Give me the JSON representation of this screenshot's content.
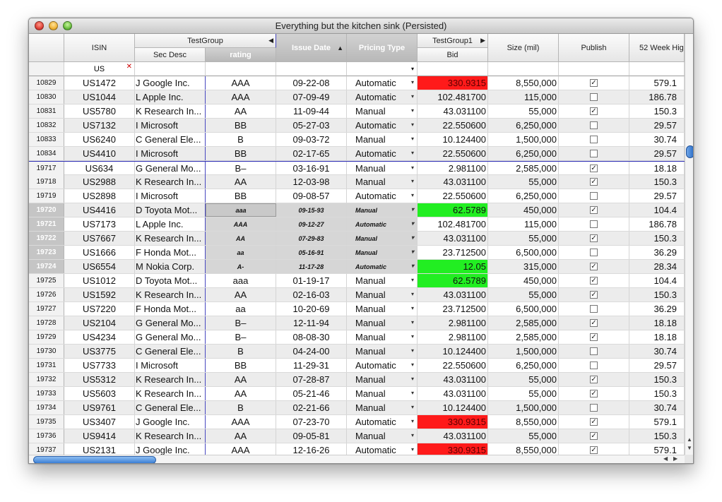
{
  "window": {
    "title": "Everything but the kitchen sink (Persisted)"
  },
  "headers": {
    "isin": "ISIN",
    "testgroup": "TestGroup",
    "sec_desc": "Sec Desc",
    "rating": "rating",
    "issue_date": "Issue Date",
    "pricing_type": "Pricing Type",
    "testgroup1": "TestGroup1",
    "bid": "Bid",
    "size": "Size (mil)",
    "publish": "Publish",
    "week52": "52 Week Hig"
  },
  "filter": {
    "isin": "US"
  },
  "colors": {
    "red_bid": "#ff1a1a",
    "green_bid": "#22ee22",
    "group_line": "#2d2db4",
    "scroll_thumb": "#3b7ed4"
  },
  "rows": [
    {
      "id": "10829",
      "isin": "US1472",
      "desc": "J Google Inc.",
      "rating": "AAA",
      "date": "09-22-08",
      "ptype": "Automatic",
      "bid": "330.9315",
      "bidc": "red",
      "size": "8,550,000",
      "pub": true,
      "wk": "579.1"
    },
    {
      "id": "10830",
      "isin": "US1044",
      "desc": "L Apple Inc.",
      "rating": "AAA",
      "date": "07-09-49",
      "ptype": "Automatic",
      "bid": "102.481700",
      "bidc": "",
      "size": "115,000",
      "pub": false,
      "wk": "186.78"
    },
    {
      "id": "10831",
      "isin": "US5780",
      "desc": "K Research In...",
      "rating": "AA",
      "date": "11-09-44",
      "ptype": "Manual",
      "bid": "43.031100",
      "bidc": "",
      "size": "55,000",
      "pub": true,
      "wk": "150.3"
    },
    {
      "id": "10832",
      "isin": "US7132",
      "desc": "I Microsoft",
      "rating": "BB",
      "date": "05-27-03",
      "ptype": "Automatic",
      "bid": "22.550600",
      "bidc": "",
      "size": "6,250,000",
      "pub": false,
      "wk": "29.57"
    },
    {
      "id": "10833",
      "isin": "US6240",
      "desc": "C General Ele...",
      "rating": "B",
      "date": "09-03-72",
      "ptype": "Manual",
      "bid": "10.124400",
      "bidc": "",
      "size": "1,500,000",
      "pub": false,
      "wk": "30.74"
    },
    {
      "id": "10834",
      "isin": "US4410",
      "desc": "I Microsoft",
      "rating": "BB",
      "date": "02-17-65",
      "ptype": "Automatic",
      "bid": "22.550600",
      "bidc": "",
      "size": "6,250,000",
      "pub": false,
      "wk": "29.57"
    },
    {
      "id": "19717",
      "isin": "US634",
      "desc": "G General Mo...",
      "rating": "B–",
      "date": "03-16-91",
      "ptype": "Manual",
      "bid": "2.981100",
      "bidc": "",
      "size": "2,585,000",
      "pub": true,
      "wk": "18.18",
      "gtop": true
    },
    {
      "id": "19718",
      "isin": "US2988",
      "desc": "K Research In...",
      "rating": "AA",
      "date": "12-03-98",
      "ptype": "Manual",
      "bid": "43.031100",
      "bidc": "",
      "size": "55,000",
      "pub": true,
      "wk": "150.3"
    },
    {
      "id": "19719",
      "isin": "US2898",
      "desc": "I Microsoft",
      "rating": "BB",
      "date": "09-08-57",
      "ptype": "Automatic",
      "bid": "22.550600",
      "bidc": "",
      "size": "6,250,000",
      "pub": false,
      "wk": "29.57"
    },
    {
      "id": "19720",
      "isin": "US4416",
      "desc": "D Toyota Mot...",
      "rating": "aaa",
      "date": "09-15-93",
      "ptype": "Manual",
      "bid": "62.5789",
      "bidc": "green",
      "size": "450,000",
      "pub": true,
      "wk": "104.4",
      "sel": true,
      "first": true
    },
    {
      "id": "19721",
      "isin": "US7173",
      "desc": "L Apple Inc.",
      "rating": "AAA",
      "date": "09-12-27",
      "ptype": "Automatic",
      "bid": "102.481700",
      "bidc": "",
      "size": "115,000",
      "pub": false,
      "wk": "186.78",
      "sel": true
    },
    {
      "id": "19722",
      "isin": "US7667",
      "desc": "K Research In...",
      "rating": "AA",
      "date": "07-29-83",
      "ptype": "Manual",
      "bid": "43.031100",
      "bidc": "",
      "size": "55,000",
      "pub": true,
      "wk": "150.3",
      "sel": true
    },
    {
      "id": "19723",
      "isin": "US1666",
      "desc": "F Honda Mot...",
      "rating": "aa",
      "date": "05-16-91",
      "ptype": "Manual",
      "bid": "23.712500",
      "bidc": "",
      "size": "6,500,000",
      "pub": false,
      "wk": "36.29",
      "sel": true
    },
    {
      "id": "19724",
      "isin": "US6554",
      "desc": "M Nokia Corp.",
      "rating": "A-",
      "date": "11-17-28",
      "ptype": "Automatic",
      "bid": "12.05",
      "bidc": "green",
      "size": "315,000",
      "pub": true,
      "wk": "28.34",
      "sel": true
    },
    {
      "id": "19725",
      "isin": "US1012",
      "desc": "D Toyota Mot...",
      "rating": "aaa",
      "date": "01-19-17",
      "ptype": "Manual",
      "bid": "62.5789",
      "bidc": "green",
      "size": "450,000",
      "pub": true,
      "wk": "104.4"
    },
    {
      "id": "19726",
      "isin": "US1592",
      "desc": "K Research In...",
      "rating": "AA",
      "date": "02-16-03",
      "ptype": "Manual",
      "bid": "43.031100",
      "bidc": "",
      "size": "55,000",
      "pub": true,
      "wk": "150.3"
    },
    {
      "id": "19727",
      "isin": "US7220",
      "desc": "F Honda Mot...",
      "rating": "aa",
      "date": "10-20-69",
      "ptype": "Manual",
      "bid": "23.712500",
      "bidc": "",
      "size": "6,500,000",
      "pub": false,
      "wk": "36.29"
    },
    {
      "id": "19728",
      "isin": "US2104",
      "desc": "G General Mo...",
      "rating": "B–",
      "date": "12-11-94",
      "ptype": "Manual",
      "bid": "2.981100",
      "bidc": "",
      "size": "2,585,000",
      "pub": true,
      "wk": "18.18"
    },
    {
      "id": "19729",
      "isin": "US4234",
      "desc": "G General Mo...",
      "rating": "B–",
      "date": "08-08-30",
      "ptype": "Manual",
      "bid": "2.981100",
      "bidc": "",
      "size": "2,585,000",
      "pub": true,
      "wk": "18.18"
    },
    {
      "id": "19730",
      "isin": "US3775",
      "desc": "C General Ele...",
      "rating": "B",
      "date": "04-24-00",
      "ptype": "Manual",
      "bid": "10.124400",
      "bidc": "",
      "size": "1,500,000",
      "pub": false,
      "wk": "30.74"
    },
    {
      "id": "19731",
      "isin": "US7733",
      "desc": "I Microsoft",
      "rating": "BB",
      "date": "11-29-31",
      "ptype": "Automatic",
      "bid": "22.550600",
      "bidc": "",
      "size": "6,250,000",
      "pub": false,
      "wk": "29.57"
    },
    {
      "id": "19732",
      "isin": "US5312",
      "desc": "K Research In...",
      "rating": "AA",
      "date": "07-28-87",
      "ptype": "Manual",
      "bid": "43.031100",
      "bidc": "",
      "size": "55,000",
      "pub": true,
      "wk": "150.3"
    },
    {
      "id": "19733",
      "isin": "US5603",
      "desc": "K Research In...",
      "rating": "AA",
      "date": "05-21-46",
      "ptype": "Manual",
      "bid": "43.031100",
      "bidc": "",
      "size": "55,000",
      "pub": true,
      "wk": "150.3"
    },
    {
      "id": "19734",
      "isin": "US9761",
      "desc": "C General Ele...",
      "rating": "B",
      "date": "02-21-66",
      "ptype": "Manual",
      "bid": "10.124400",
      "bidc": "",
      "size": "1,500,000",
      "pub": false,
      "wk": "30.74"
    },
    {
      "id": "19735",
      "isin": "US3407",
      "desc": "J Google Inc.",
      "rating": "AAA",
      "date": "07-23-70",
      "ptype": "Automatic",
      "bid": "330.9315",
      "bidc": "red",
      "size": "8,550,000",
      "pub": true,
      "wk": "579.1"
    },
    {
      "id": "19736",
      "isin": "US9414",
      "desc": "K Research In...",
      "rating": "AA",
      "date": "09-05-81",
      "ptype": "Manual",
      "bid": "43.031100",
      "bidc": "",
      "size": "55,000",
      "pub": true,
      "wk": "150.3"
    },
    {
      "id": "19737",
      "isin": "US2131",
      "desc": "J Google Inc.",
      "rating": "AAA",
      "date": "12-16-26",
      "ptype": "Automatic",
      "bid": "330.9315",
      "bidc": "red",
      "size": "8,550,000",
      "pub": true,
      "wk": "579.1"
    }
  ]
}
